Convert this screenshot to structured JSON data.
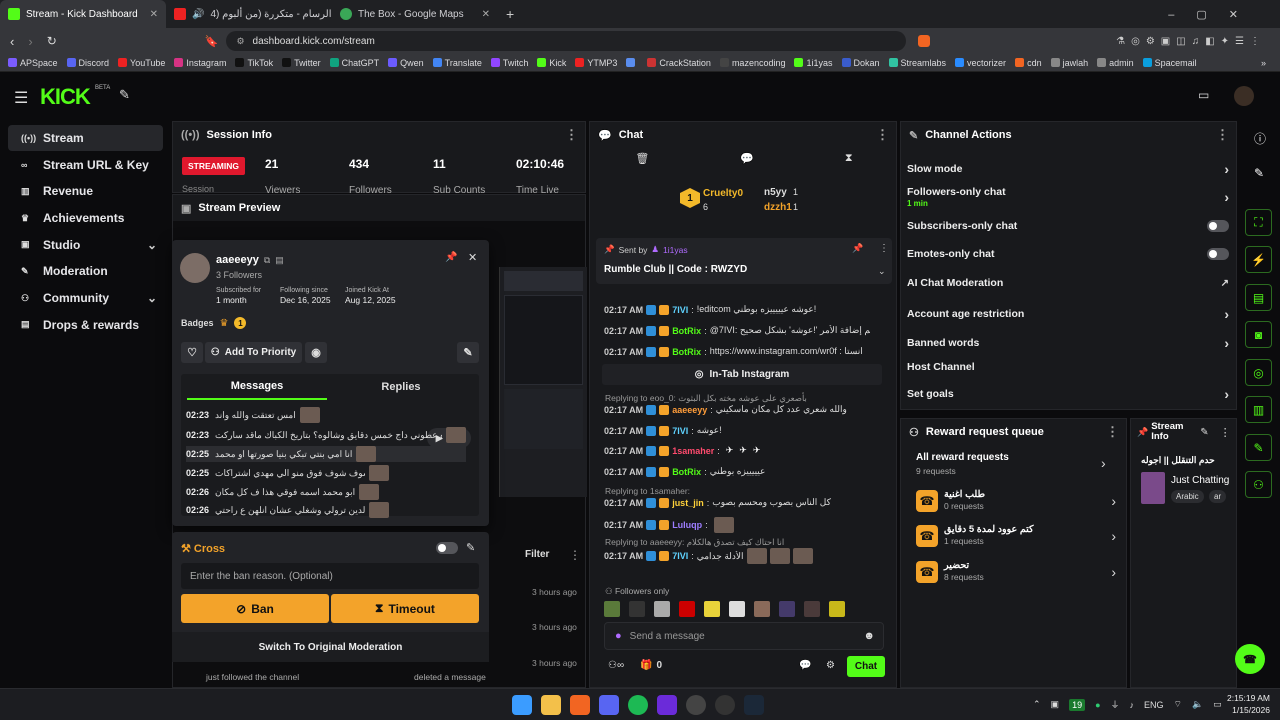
{
  "browser": {
    "tabs": [
      {
        "title": "Stream - Kick Dashboard"
      },
      {
        "title": "حسام الرسام - متكررة (من ألبوم (4"
      },
      {
        "title": "The Box - Google Maps"
      }
    ],
    "url": "dashboard.kick.com/stream",
    "bookmarks": [
      "APSpace",
      "Discord",
      "YouTube",
      "Instagram",
      "TikTok",
      "Twitter",
      "ChatGPT",
      "Qwen",
      "Translate",
      "Twitch",
      "Kick",
      "YTMP3",
      "",
      "CrackStation",
      "mazencoding",
      "1i1yas",
      "Dokan",
      "Streamlabs",
      "vectorizer",
      "cdn",
      "jawlah",
      "admin",
      "Spacemail"
    ]
  },
  "brand": {
    "logo": "KICK",
    "beta": "BETA"
  },
  "sidenav": [
    {
      "label": "Stream",
      "icon": "broadcast-icon"
    },
    {
      "label": "Stream URL & Key",
      "icon": "link-icon"
    },
    {
      "label": "Revenue",
      "icon": "chart-icon"
    },
    {
      "label": "Achievements",
      "icon": "trophy-icon"
    },
    {
      "label": "Studio",
      "icon": "studio-icon"
    },
    {
      "label": "Moderation",
      "icon": "wrench-icon"
    },
    {
      "label": "Community",
      "icon": "people-icon"
    },
    {
      "label": "Drops & rewards",
      "icon": "gift-icon"
    }
  ],
  "session": {
    "title": "Session Info",
    "badge": "STREAMING",
    "badge_sub": "Session",
    "stats": [
      {
        "value": "21",
        "label": "Viewers"
      },
      {
        "value": "434",
        "label": "Followers"
      },
      {
        "value": "11",
        "label": "Sub Counts"
      },
      {
        "value": "02:10:46",
        "label": "Time Live"
      }
    ]
  },
  "preview": {
    "title": "Stream Preview"
  },
  "user_card": {
    "username": "aaeeeyy",
    "followers": "3 Followers",
    "subscribed_label": "Subscribed for",
    "subscribed_value": "1 month",
    "following_label": "Following since",
    "following_value": "Dec 16, 2025",
    "joined_label": "Joined Kick At",
    "joined_value": "Aug 12, 2025",
    "badges_label": "Badges",
    "badge_count": "1",
    "add_priority": "Add To Priority",
    "tab_messages": "Messages",
    "tab_replies": "Replies",
    "messages": [
      {
        "time": "02:23",
        "text": "امس تعتقت والله واند"
      },
      {
        "time": "02:23",
        "text": "باك فايزه عطوني داج خمس دقايق وشالوه؟ بتاريخ الكباك ماقد ساركت"
      },
      {
        "time": "02:25",
        "text": "انا امي بنتي تبكي بنيا صورتها او محمد"
      },
      {
        "time": "02:25",
        "text": "شوف شوف فوق منو الي مهدي اشتراكات"
      },
      {
        "time": "02:26",
        "text": "ابو محمد اسمه فوقي هذا ف كل مكان"
      },
      {
        "time": "02:26",
        "text": "الدين ترولي وشغلي عشان انلهن ع راحتي"
      }
    ]
  },
  "cross": {
    "title": "Cross",
    "placeholder": "Enter the ban reason. (Optional)",
    "ban": "Ban",
    "timeout": "Timeout",
    "switch": "Switch To Original Moderation"
  },
  "activity": {
    "filter": "Filter",
    "times": [
      "3 hours ago",
      "3 hours ago",
      "3 hours ago"
    ],
    "bottom_left": "just followed the channel",
    "bottom_right": "deleted a message"
  },
  "chat": {
    "title": "Chat",
    "top_gifters": [
      {
        "name": "Cruelty0",
        "count": "6"
      },
      {
        "name": "n5yy",
        "count": "1"
      },
      {
        "name": "dzzh1",
        "count": "1"
      }
    ],
    "pinned_sent_by": "Sent by",
    "pinned_user": "1i1yas",
    "pinned_text": "Rumble Club || Code : RWZYD",
    "lines": [
      {
        "time": "02:17 AM",
        "user": "7IVI",
        "color": "#5fd3ff",
        "text": "!editcom عوشه عيييييزه بوطني!"
      },
      {
        "time": "02:17 AM",
        "user": "BotRix",
        "color": "#53fc18",
        "text": "@7IVI: تم إضافة الأمر '!عوشه' بشكل صحيح"
      },
      {
        "time": "02:17 AM",
        "user": "BotRix",
        "color": "#53fc18",
        "text": "https://www.instagram.com/wr0f : انستا"
      },
      {
        "time": "02:17 AM",
        "user": "aaeeeyy",
        "color": "#ff9d3a",
        "text": "والله شعري عدد كل مكان ماسكيني"
      },
      {
        "time": "02:17 AM",
        "user": "7IVI",
        "color": "#5fd3ff",
        "text": "عوشه!"
      },
      {
        "time": "02:17 AM",
        "user": "1samaher",
        "color": "#ff4b6e",
        "text": ""
      },
      {
        "time": "02:17 AM",
        "user": "BotRix",
        "color": "#53fc18",
        "text": "عيييييزه بوطني"
      },
      {
        "time": "02:17 AM",
        "user": "just_jin",
        "color": "#ffd23a",
        "text": "كل الناس بصوب ومحسم بصوب"
      },
      {
        "time": "02:17 AM",
        "user": "Luluqp",
        "color": "#9d7dff",
        "text": ""
      },
      {
        "time": "02:17 AM",
        "user": "7IVI",
        "color": "#5fd3ff",
        "text": "الأدلة جدامي"
      }
    ],
    "instagram_btn": "In-Tab Instagram",
    "reply1": "Replying to eoo_0: بأصعري على عوشه مخته بكل البثوث",
    "reply2": "Replying to 1samaher:",
    "reply3": "Replying to aaeeeyy: انا احتاك كيف تصدق هالكلام",
    "followers_only": "Followers only",
    "send_placeholder": "Send a message",
    "count": "0",
    "chat_btn": "Chat"
  },
  "channel_actions": {
    "title": "Channel Actions",
    "items": [
      {
        "label": "Slow mode"
      },
      {
        "label": "Followers-only chat",
        "sub": "1 min"
      },
      {
        "label": "Subscribers-only chat"
      },
      {
        "label": "Emotes-only chat"
      },
      {
        "label": "AI Chat Moderation"
      },
      {
        "label": "Account age restriction"
      },
      {
        "label": "Banned words"
      },
      {
        "label": "Host Channel"
      },
      {
        "label": "Set goals"
      }
    ]
  },
  "reward_queue": {
    "title": "Reward request queue",
    "all_label": "All reward requests",
    "all_count": "9 requests",
    "items": [
      {
        "title": "طلب اغنية",
        "count": "0 requests"
      },
      {
        "title": "كتم عوود لمدة 5 دقايق",
        "count": "1 requests"
      },
      {
        "title": "تحضير",
        "count": "8 requests"
      }
    ]
  },
  "stream_info": {
    "title": "Stream Info",
    "stream_title": "حدم التنقلل || اجوله",
    "category": "Just Chatting",
    "tags": [
      "Arabic",
      "ar"
    ]
  },
  "taskbar": {
    "lang": "ENG",
    "time": "2:15:19 AM",
    "date": "1/15/2026",
    "temp": "19"
  }
}
